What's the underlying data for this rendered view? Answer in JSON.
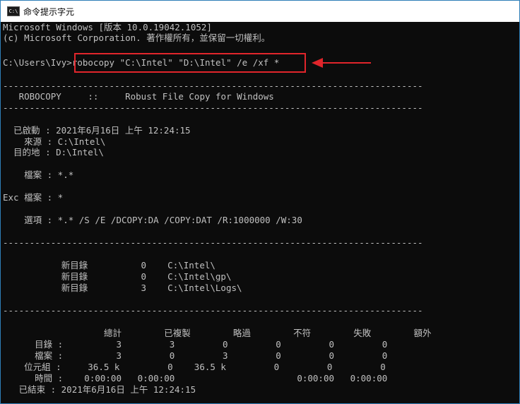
{
  "window": {
    "title": "命令提示字元",
    "icon": "C:\\",
    "colors": {
      "accent": "#e1252b",
      "text": "#c0c0c0",
      "background": "#0c0c0c"
    }
  },
  "console": {
    "lines": [
      "Microsoft Windows [版本 10.0.19042.1052]",
      "(c) Microsoft Corporation. 著作權所有，並保留一切權利。",
      "",
      "C:\\Users\\Ivy>robocopy \"C:\\Intel\" \"D:\\Intel\" /e /xf *",
      "",
      "-------------------------------------------------------------------------------",
      "   ROBOCOPY     ::     Robust File Copy for Windows",
      "-------------------------------------------------------------------------------",
      "",
      "  已啟動 : 2021年6月16日 上午 12:24:15",
      "    來源 : C:\\Intel\\",
      "  目的地 : D:\\Intel\\",
      "",
      "    檔案 : *.*",
      "",
      "Exc 檔案 : *",
      "",
      "    選項 : *.* /S /E /DCOPY:DA /COPY:DAT /R:1000000 /W:30",
      "",
      "-------------------------------------------------------------------------------",
      "",
      "           新目錄          0    C:\\Intel\\",
      "           新目錄          0    C:\\Intel\\gp\\",
      "           新目錄          3    C:\\Intel\\Logs\\",
      "",
      "-------------------------------------------------------------------------------",
      "",
      "                   總計        已複製        略過        不符        失敗        額外",
      "      目錄 :          3         3         0         0         0         0",
      "      檔案 :          3         0         3         0         0         0",
      "    位元組 :     36.5 k         0    36.5 k         0         0         0",
      "      時間 :    0:00:00   0:00:00                       0:00:00   0:00:00",
      "   已結束 : 2021年6月16日 上午 12:24:15"
    ]
  }
}
